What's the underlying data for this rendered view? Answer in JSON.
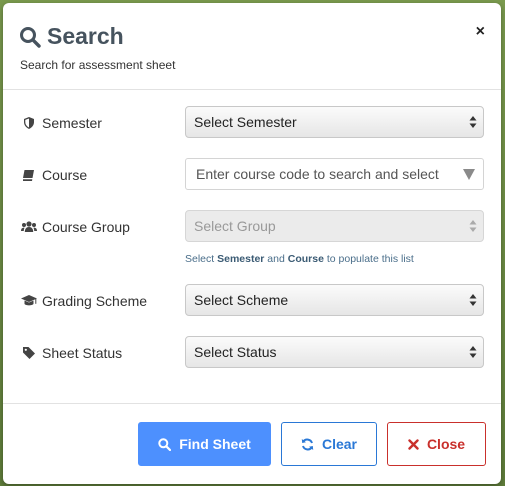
{
  "modal": {
    "title": "Search",
    "subtitle": "Search for assessment sheet",
    "close_symbol": "×"
  },
  "fields": {
    "semester": {
      "label": "Semester",
      "icon": "shield-icon",
      "value": "Select Semester"
    },
    "course": {
      "label": "Course",
      "icon": "book-icon",
      "placeholder": "Enter course code to search and select"
    },
    "course_group": {
      "label": "Course Group",
      "icon": "users-icon",
      "value": "Select Group",
      "disabled": true,
      "help_prefix": "Select ",
      "help_semester": "Semester",
      "help_and": " and ",
      "help_course": "Course",
      "help_suffix": " to populate this list"
    },
    "grading_scheme": {
      "label": "Grading Scheme",
      "icon": "graduation-cap-icon",
      "value": "Select Scheme"
    },
    "sheet_status": {
      "label": "Sheet Status",
      "icon": "tag-icon",
      "value": "Select Status"
    }
  },
  "footer": {
    "find_label": "Find Sheet",
    "clear_label": "Clear",
    "close_label": "Close"
  },
  "colors": {
    "primary": "#4d90fe",
    "info": "#2a78d6",
    "danger": "#c9302c",
    "title": "#46535e"
  }
}
